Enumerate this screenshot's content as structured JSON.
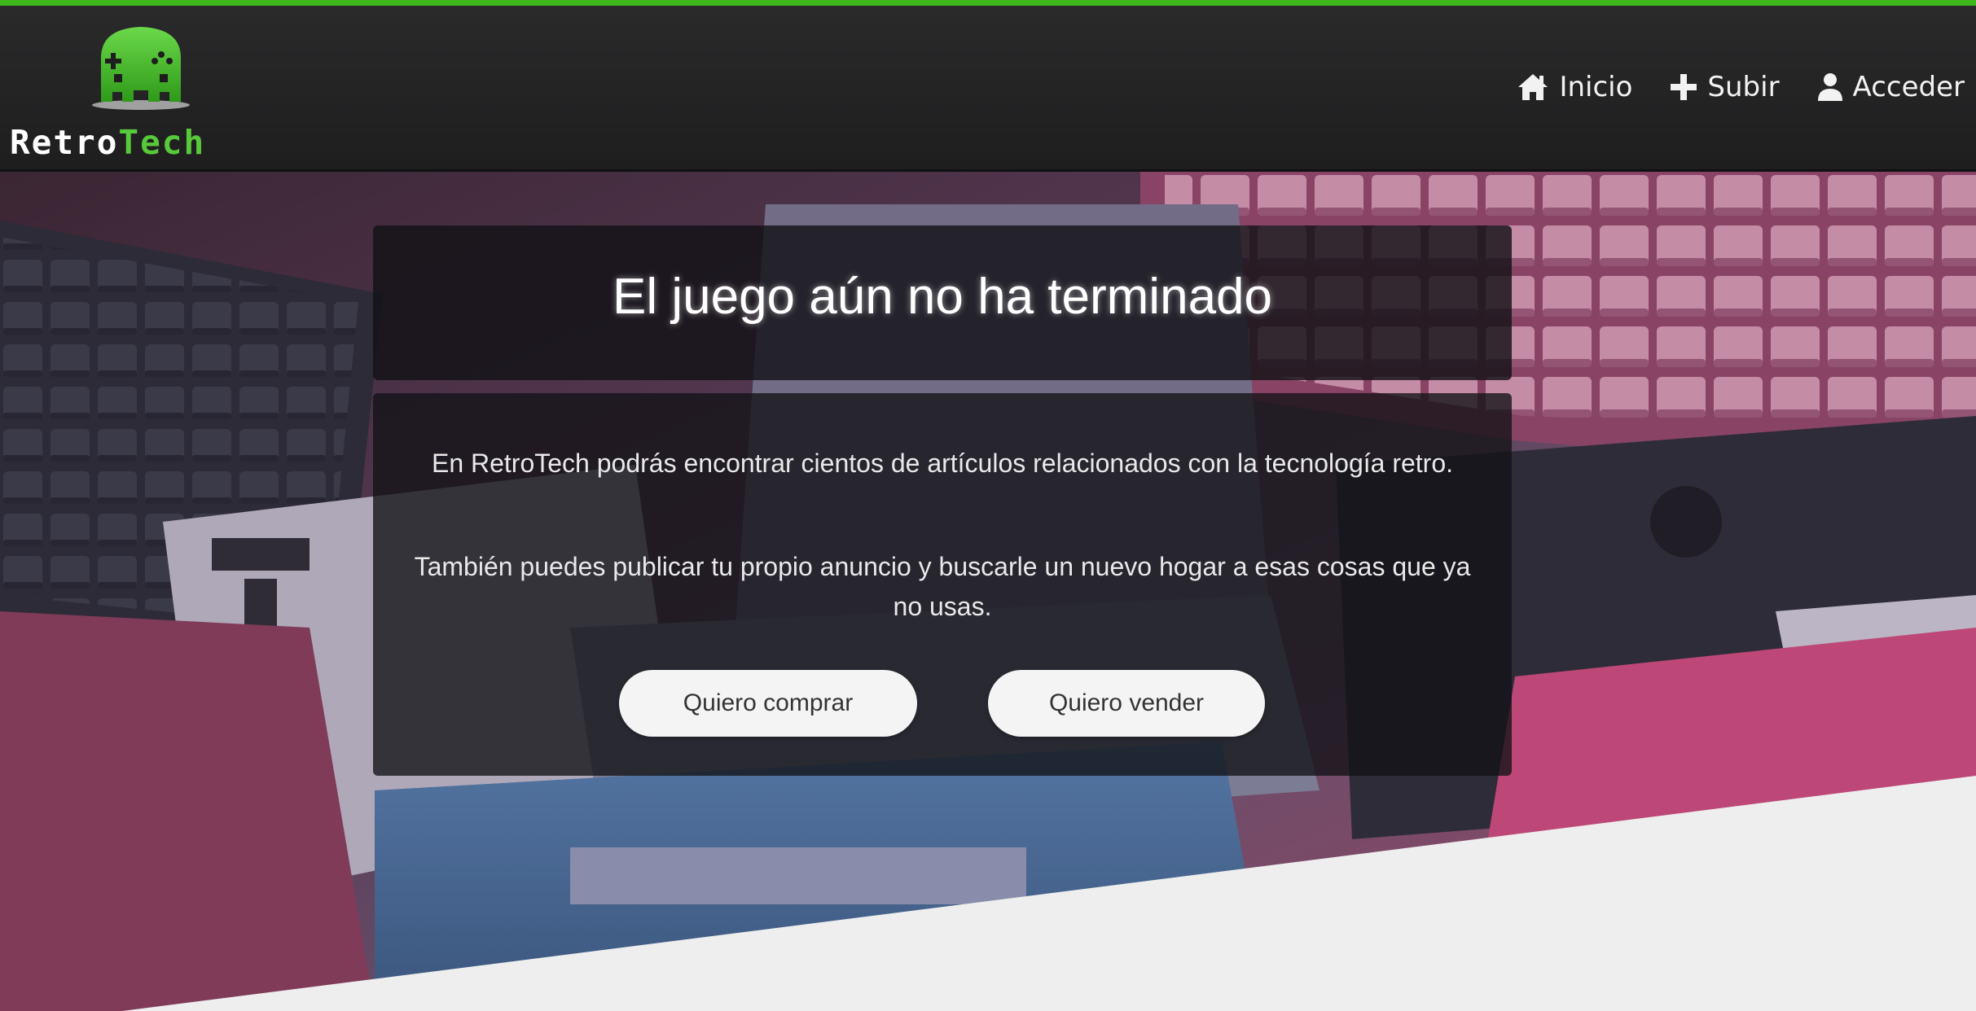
{
  "brand": {
    "name_part_a": "Retro",
    "name_part_b": "Tech",
    "logo_icon": "gamepad-space-invader-logo"
  },
  "nav": {
    "items": [
      {
        "label": "Inicio",
        "icon": "home-icon"
      },
      {
        "label": "Subir",
        "icon": "plus-icon"
      },
      {
        "label": "Acceder",
        "icon": "user-icon"
      }
    ]
  },
  "hero": {
    "title": "El juego aún no ha terminado",
    "paragraph_1": "En RetroTech podrás encontrar cientos de artículos relacionados con la tecnología retro.",
    "paragraph_2": "También puedes publicar tu propio anuncio y buscarle un nuevo hogar a esas cosas que ya no usas.",
    "buy_button": "Quiero comprar",
    "sell_button": "Quiero vender"
  },
  "colors": {
    "accent": "#3fb81f",
    "brand_green": "#58c93a",
    "navbar": "#232324",
    "hero_tint_pink": "#c9557e",
    "hero_tint_blue": "#4a7fb5"
  }
}
